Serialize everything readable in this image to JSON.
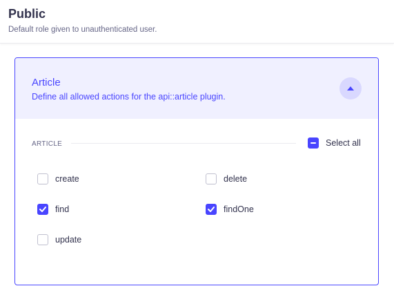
{
  "header": {
    "title": "Public",
    "subtitle": "Default role given to unauthenticated user."
  },
  "plugin": {
    "name": "Article",
    "description": "Define all allowed actions for the api::article plugin.",
    "expanded": true
  },
  "section": {
    "label": "ARTICLE",
    "select_all_label": "Select all",
    "select_all_state": "indeterminate"
  },
  "permissions": [
    {
      "label": "create",
      "checked": false
    },
    {
      "label": "delete",
      "checked": false
    },
    {
      "label": "find",
      "checked": true
    },
    {
      "label": "findOne",
      "checked": true
    },
    {
      "label": "update",
      "checked": false
    }
  ],
  "colors": {
    "accent": "#4945ff",
    "accent_bg": "#f0f0ff",
    "text": "#32324d",
    "muted": "#666687",
    "border": "#c0c0cf"
  }
}
